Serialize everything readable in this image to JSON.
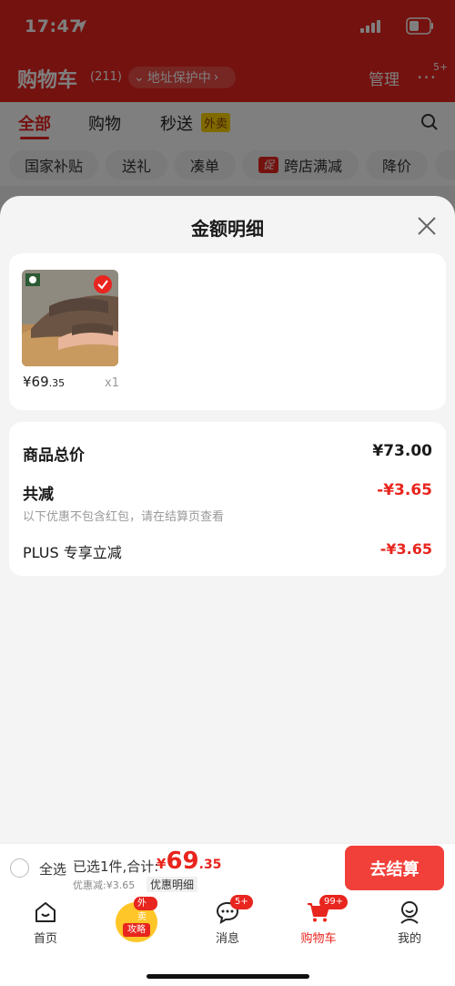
{
  "status_bar": {
    "time": "17:47"
  },
  "cart": {
    "title": "购物车",
    "count": "(211)",
    "address_pill": "地址保护中",
    "manage": "管理",
    "more_badge": "5+"
  },
  "tabs": [
    {
      "label": "全部"
    },
    {
      "label": "购物"
    },
    {
      "label": "秒送"
    }
  ],
  "tab_tag": "外卖",
  "chips": [
    {
      "label": "国家补贴"
    },
    {
      "label": "送礼"
    },
    {
      "label": "凑单"
    },
    {
      "label": "跨店满减",
      "icon_text": "促"
    },
    {
      "label": "降价"
    }
  ],
  "sheet": {
    "title": "金额明细",
    "product": {
      "price_symbol": "¥",
      "price_int": "69",
      "price_dec": ".35",
      "quantity": "x1"
    },
    "details": {
      "total_label": "商品总价",
      "total_value": "¥73.00",
      "reduce_label": "共减",
      "reduce_value": "-¥3.65",
      "reduce_note": "以下优惠不包含红包，请在结算页查看",
      "plus_label": "PLUS 专享立减",
      "plus_value": "-¥3.65"
    }
  },
  "checkout": {
    "select_all": "全选",
    "selected_text": "已选1件,合计:",
    "price_symbol": "¥",
    "price_int": "69",
    "price_dec": ".35",
    "discount_text": "优惠减:¥3.65",
    "detail_link": "优惠明细",
    "button": "去结算"
  },
  "tab_bar": {
    "home": "首页",
    "promo_label": "攻略",
    "promo_badge": "外卖",
    "messages": "消息",
    "messages_badge": "5+",
    "cart": "购物车",
    "cart_badge": "99+",
    "mine": "我的"
  },
  "colors": {
    "accent": "#e8251e",
    "button": "#f1403a"
  }
}
